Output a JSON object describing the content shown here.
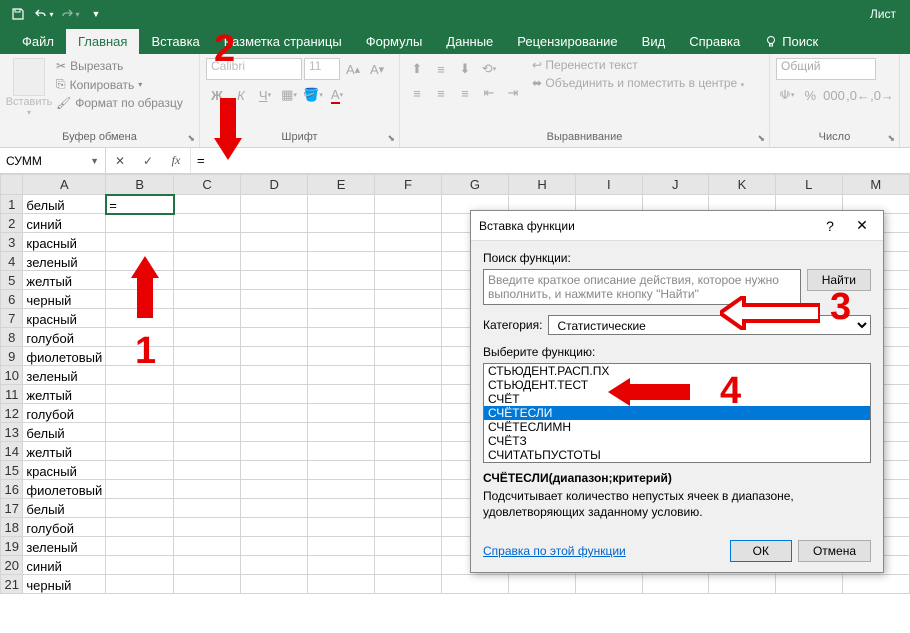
{
  "titlebar": {
    "sheet": "Лист"
  },
  "tabs": {
    "file": "Файл",
    "home": "Главная",
    "insert": "Вставка",
    "layout": "Разметка страницы",
    "formulas": "Формулы",
    "data": "Данные",
    "review": "Рецензирование",
    "view": "Вид",
    "help": "Справка",
    "search": "Поиск"
  },
  "ribbon": {
    "paste": "Вставить",
    "cut": "Вырезать",
    "copy": "Копировать",
    "format_painter": "Формат по образцу",
    "clipboard": "Буфер обмена",
    "font_name": "Calibri",
    "font_size": "11",
    "font_group": "Шрифт",
    "wrap": "Перенести текст",
    "merge": "Объединить и поместить в центре",
    "align_group": "Выравнивание",
    "number_format": "Общий",
    "number_group": "Число"
  },
  "formula_bar": {
    "name_box": "СУММ",
    "formula": "="
  },
  "columns": [
    "A",
    "B",
    "C",
    "D",
    "E",
    "F",
    "G",
    "H",
    "I",
    "J",
    "K",
    "L",
    "M"
  ],
  "rows": [
    "белый",
    "синий",
    "красный",
    "зеленый",
    "желтый",
    "черный",
    "красный",
    "голубой",
    "фиолетовый",
    "зеленый",
    "желтый",
    "голубой",
    "белый",
    "желтый",
    "красный",
    "фиолетовый",
    "белый",
    "голубой",
    "зеленый",
    "синий",
    "черный"
  ],
  "active_cell_value": "=",
  "dialog": {
    "title": "Вставка функции",
    "search_label": "Поиск функции:",
    "search_placeholder": "Введите краткое описание действия, которое нужно выполнить, и нажмите кнопку \"Найти\"",
    "find_btn": "Найти",
    "category_label": "Категория:",
    "category_value": "Статистические",
    "select_label": "Выберите функцию:",
    "functions": [
      "СТЬЮДЕНТ.РАСП.ПХ",
      "СТЬЮДЕНТ.ТЕСТ",
      "СЧЁТ",
      "СЧЁТЕСЛИ",
      "СЧЁТЕСЛИМН",
      "СЧЁТЗ",
      "СЧИТАТЬПУСТОТЫ"
    ],
    "selected_index": 3,
    "signature": "СЧЁТЕСЛИ(диапазон;критерий)",
    "description": "Подсчитывает количество непустых ячеек в диапазоне, удовлетворяющих заданному условию.",
    "help_link": "Справка по этой функции",
    "ok": "ОК",
    "cancel": "Отмена"
  },
  "annotations": {
    "n1": "1",
    "n2": "2",
    "n3": "3",
    "n4": "4"
  }
}
